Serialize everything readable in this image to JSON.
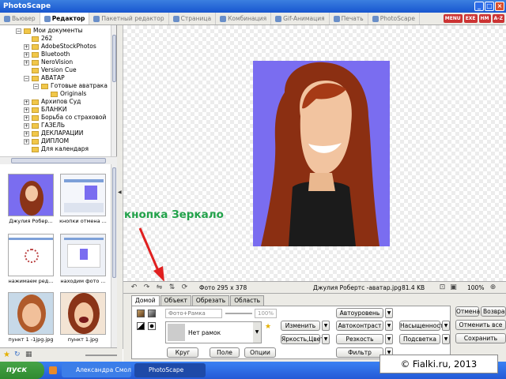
{
  "window": {
    "title": "PhotoScape"
  },
  "tabs": [
    {
      "label": "Вьювер",
      "active": false
    },
    {
      "label": "Редактор",
      "active": true
    },
    {
      "label": "Пакетный редактор",
      "active": false
    },
    {
      "label": "Страница",
      "active": false
    },
    {
      "label": "Комбинация",
      "active": false
    },
    {
      "label": "Gif-Анимация",
      "active": false
    },
    {
      "label": "Печать",
      "active": false
    },
    {
      "label": "PhotoScape",
      "active": false
    }
  ],
  "top_badges": [
    "MENU",
    "EXE",
    "HM",
    "A-Z"
  ],
  "folder_tree": [
    {
      "label": "Мои документы",
      "level": 0
    },
    {
      "label": "262",
      "level": 1
    },
    {
      "label": "AdobeStockPhotos",
      "level": 1
    },
    {
      "label": "Bluetooth",
      "level": 1
    },
    {
      "label": "NeroVision",
      "level": 1
    },
    {
      "label": "Version Cue",
      "level": 1
    },
    {
      "label": "АВАТАР",
      "level": 1
    },
    {
      "label": "Готовые аватрака",
      "level": 2
    },
    {
      "label": "Originals",
      "level": 3
    },
    {
      "label": "Архипов Суд",
      "level": 1
    },
    {
      "label": "БЛАНКИ",
      "level": 1
    },
    {
      "label": "Борьба со страховой",
      "level": 1
    },
    {
      "label": "ГАЗЕЛЬ",
      "level": 1
    },
    {
      "label": "ДЕКЛАРАЦИИ",
      "level": 1
    },
    {
      "label": "ДИПЛОМ",
      "level": 1
    },
    {
      "label": "Для календаря",
      "level": 1
    }
  ],
  "thumbnails": [
    {
      "caption": "Джулия Робер..."
    },
    {
      "caption": "кнопки отмена ..."
    },
    {
      "caption": "нажимаем ред..."
    },
    {
      "caption": "находим фото ..."
    },
    {
      "caption": "пункт 1 -1jpg.jpg"
    },
    {
      "caption": "пункт 1.jpg"
    }
  ],
  "annotation": "кнопка Зеркало",
  "status": {
    "photo_size": "Фото 295 x 378",
    "filename": "Джулия Робертс -аватар.jpg",
    "filesize": "81.4 KB",
    "zoom": "100%"
  },
  "panel_tabs": [
    {
      "label": "Домой",
      "active": true
    },
    {
      "label": "Объект",
      "active": false
    },
    {
      "label": "Обрезать",
      "active": false
    },
    {
      "label": "Область",
      "active": false
    }
  ],
  "frame": {
    "input_placeholder": "Фото+Рамка",
    "opacity": "100%",
    "selected": "Нет рамок"
  },
  "buttons": {
    "round": "Круг",
    "field": "Поле",
    "options": "Опции",
    "change": "Изменить",
    "brightness": "Яркость,Цвет",
    "autolevel": "Автоуровень",
    "autocontrast": "Автоконтраст",
    "sharpness": "Резкость",
    "filter": "Фильтр",
    "saturation": "Насыщенность",
    "backlight": "Подсветка",
    "cancel": "Отмена",
    "return": "Возвра",
    "cancel_all": "Отменить все",
    "save": "Сохранить"
  },
  "taskbar": {
    "start": "пуск",
    "tasks": [
      "Александра Смолен...",
      "PhotoScape"
    ]
  },
  "watermark": "© Fialki.ru, 2013",
  "colors": {
    "photo_bg": "#7a6df0",
    "annotation": "#22a24a",
    "arrow": "#e02020",
    "titlebar": "#1856cf"
  }
}
